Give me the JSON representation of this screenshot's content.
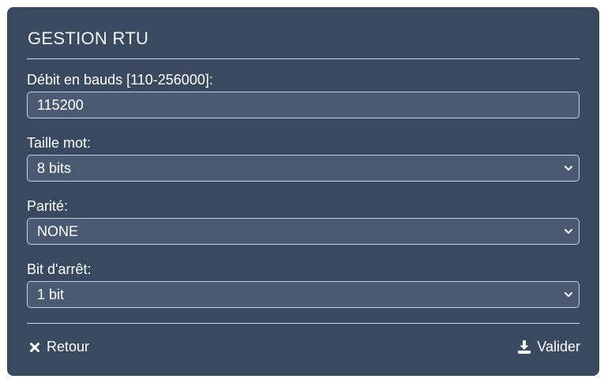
{
  "header": {
    "title": "GESTION RTU"
  },
  "form": {
    "baud_rate": {
      "label": "Débit en bauds [110-256000]:",
      "value": "115200"
    },
    "word_size": {
      "label": "Taille mot:",
      "value": "8 bits"
    },
    "parity": {
      "label": "Parité:",
      "value": "NONE"
    },
    "stop_bit": {
      "label": "Bit d'arrêt:",
      "value": "1 bit"
    }
  },
  "footer": {
    "back_label": "Retour",
    "back_icon": "close-icon",
    "submit_label": "Valider",
    "submit_icon": "download-icon"
  },
  "colors": {
    "panel_bg": "#394a60",
    "field_bg": "#4a5a72",
    "field_border": "#c9d0da",
    "text": "#ffffff"
  }
}
